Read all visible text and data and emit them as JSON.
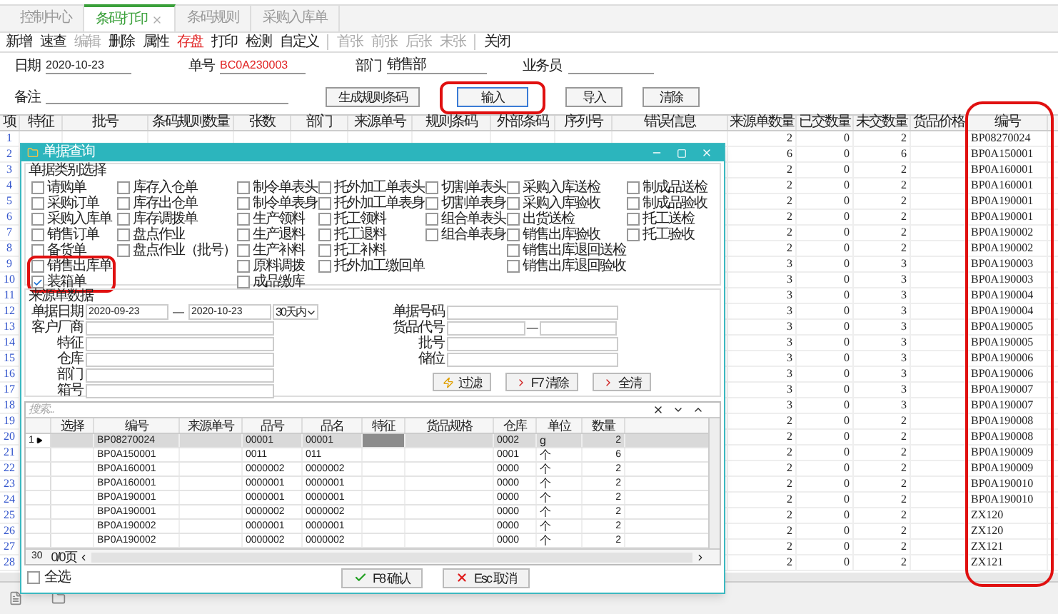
{
  "tabs": [
    {
      "label": "控制中心",
      "selected": false,
      "closable": false
    },
    {
      "label": "条码打印",
      "selected": true,
      "closable": true
    },
    {
      "label": "条码规则",
      "selected": false,
      "closable": false
    },
    {
      "label": "采购入库单",
      "selected": false,
      "closable": false
    }
  ],
  "toolbar_groups": [
    {
      "items": [
        {
          "label": "新增",
          "kind": "normal"
        },
        {
          "label": "速查",
          "kind": "normal"
        },
        {
          "label": "编辑",
          "kind": "disabled"
        },
        {
          "label": "删除",
          "kind": "normal"
        },
        {
          "label": "属性",
          "kind": "normal"
        },
        {
          "label": "存盘",
          "kind": "accent"
        },
        {
          "label": "打印",
          "kind": "normal"
        },
        {
          "label": "检测",
          "kind": "normal"
        },
        {
          "label": "自定义",
          "kind": "normal"
        }
      ]
    },
    {
      "items": [
        {
          "label": "首张",
          "kind": "disabled"
        },
        {
          "label": "前张",
          "kind": "disabled"
        },
        {
          "label": "后张",
          "kind": "disabled"
        },
        {
          "label": "末张",
          "kind": "disabled"
        }
      ]
    },
    {
      "items": [
        {
          "label": "关闭",
          "kind": "normal"
        }
      ]
    }
  ],
  "form": {
    "date": {
      "label": "日期",
      "value": "2020-10-23"
    },
    "number": {
      "label": "单号",
      "value": "BC0A230003"
    },
    "department": {
      "label": "部门",
      "value": "销售部"
    },
    "salesperson": {
      "label": "业务员"
    },
    "remark": {
      "label": "备注"
    }
  },
  "form_buttons": [
    {
      "label": "生成规则条码",
      "focused": false,
      "annotated": false
    },
    {
      "label": "输入",
      "focused": true,
      "annotated": true
    },
    {
      "label": "导入",
      "focused": false,
      "annotated": false
    },
    {
      "label": "清除",
      "focused": false,
      "annotated": false
    }
  ],
  "main_table": {
    "columns": [
      {
        "label": "项",
        "annotated": false
      },
      {
        "label": "特征",
        "annotated": false
      },
      {
        "label": "批号",
        "annotated": false
      },
      {
        "label": "条码规则数量",
        "annotated": false
      },
      {
        "label": "张数",
        "annotated": false
      },
      {
        "label": "部门",
        "annotated": false
      },
      {
        "label": "来源单号",
        "annotated": false
      },
      {
        "label": "规则条码",
        "annotated": false
      },
      {
        "label": "外部条码",
        "annotated": false
      },
      {
        "label": "序列号",
        "annotated": false
      },
      {
        "label": "错误信息",
        "annotated": false
      },
      {
        "label": "来源单数量",
        "annotated": false
      },
      {
        "label": "已交数量",
        "annotated": false
      },
      {
        "label": "未交数量",
        "annotated": false
      },
      {
        "label": "货品价格",
        "annotated": false
      },
      {
        "label": "编号",
        "annotated": true
      }
    ],
    "rows": [
      {
        "item": "1",
        "source_qty": "2",
        "delivered_qty": "0",
        "undelivered_qty": "2",
        "number": "BP08270024"
      },
      {
        "item": "2",
        "source_qty": "6",
        "delivered_qty": "0",
        "undelivered_qty": "6",
        "number": "BP0A150001"
      },
      {
        "item": "3",
        "source_qty": "2",
        "delivered_qty": "0",
        "undelivered_qty": "2",
        "number": "BP0A160001"
      },
      {
        "item": "4",
        "source_qty": "2",
        "delivered_qty": "0",
        "undelivered_qty": "2",
        "number": "BP0A160001"
      },
      {
        "item": "5",
        "source_qty": "2",
        "delivered_qty": "0",
        "undelivered_qty": "2",
        "number": "BP0A190001"
      },
      {
        "item": "6",
        "source_qty": "2",
        "delivered_qty": "0",
        "undelivered_qty": "2",
        "number": "BP0A190001"
      },
      {
        "item": "7",
        "source_qty": "2",
        "delivered_qty": "0",
        "undelivered_qty": "2",
        "number": "BP0A190002"
      },
      {
        "item": "8",
        "source_qty": "2",
        "delivered_qty": "0",
        "undelivered_qty": "2",
        "number": "BP0A190002"
      },
      {
        "item": "9",
        "source_qty": "3",
        "delivered_qty": "0",
        "undelivered_qty": "3",
        "number": "BP0A190003"
      },
      {
        "item": "10",
        "source_qty": "3",
        "delivered_qty": "0",
        "undelivered_qty": "3",
        "number": "BP0A190003"
      },
      {
        "item": "11",
        "source_qty": "3",
        "delivered_qty": "0",
        "undelivered_qty": "3",
        "number": "BP0A190004"
      },
      {
        "item": "12",
        "source_qty": "3",
        "delivered_qty": "0",
        "undelivered_qty": "3",
        "number": "BP0A190004"
      },
      {
        "item": "13",
        "source_qty": "3",
        "delivered_qty": "0",
        "undelivered_qty": "3",
        "number": "BP0A190005"
      },
      {
        "item": "14",
        "source_qty": "3",
        "delivered_qty": "0",
        "undelivered_qty": "3",
        "number": "BP0A190005"
      },
      {
        "item": "15",
        "source_qty": "3",
        "delivered_qty": "0",
        "undelivered_qty": "3",
        "number": "BP0A190006"
      },
      {
        "item": "16",
        "source_qty": "3",
        "delivered_qty": "0",
        "undelivered_qty": "3",
        "number": "BP0A190006"
      },
      {
        "item": "17",
        "source_qty": "3",
        "delivered_qty": "0",
        "undelivered_qty": "3",
        "number": "BP0A190007"
      },
      {
        "item": "18",
        "source_qty": "3",
        "delivered_qty": "0",
        "undelivered_qty": "3",
        "number": "BP0A190007"
      },
      {
        "item": "19",
        "source_qty": "2",
        "delivered_qty": "0",
        "undelivered_qty": "2",
        "number": "BP0A190008"
      },
      {
        "item": "20",
        "source_qty": "2",
        "delivered_qty": "0",
        "undelivered_qty": "2",
        "number": "BP0A190008"
      },
      {
        "item": "21",
        "source_qty": "2",
        "delivered_qty": "0",
        "undelivered_qty": "2",
        "number": "BP0A190009"
      },
      {
        "item": "22",
        "source_qty": "2",
        "delivered_qty": "0",
        "undelivered_qty": "2",
        "number": "BP0A190009"
      },
      {
        "item": "23",
        "source_qty": "2",
        "delivered_qty": "0",
        "undelivered_qty": "2",
        "number": "BP0A190010"
      },
      {
        "item": "24",
        "source_qty": "2",
        "delivered_qty": "0",
        "undelivered_qty": "2",
        "number": "BP0A190010"
      },
      {
        "item": "25",
        "source_qty": "2",
        "delivered_qty": "0",
        "undelivered_qty": "2",
        "number": "ZX120"
      },
      {
        "item": "26",
        "source_qty": "2",
        "delivered_qty": "0",
        "undelivered_qty": "2",
        "number": "ZX120"
      },
      {
        "item": "27",
        "source_qty": "2",
        "delivered_qty": "0",
        "undelivered_qty": "2",
        "number": "ZX121"
      },
      {
        "item": "28",
        "source_qty": "2",
        "delivered_qty": "0",
        "undelivered_qty": "2",
        "number": "ZX121"
      }
    ]
  },
  "dialog": {
    "title": "单据查询",
    "category_group": {
      "title": "单据类别选择",
      "columns": [
        {
          "items": [
            {
              "label": "请购单",
              "checked": false,
              "annotated": false
            },
            {
              "label": "采购订单",
              "checked": false,
              "annotated": false
            },
            {
              "label": "采购入库单",
              "checked": false,
              "annotated": false
            },
            {
              "label": "销售订单",
              "checked": false,
              "annotated": false
            },
            {
              "label": "备货单",
              "checked": false,
              "annotated": false
            },
            {
              "label": "销售出库单",
              "checked": false,
              "annotated": true
            },
            {
              "label": "装箱单",
              "checked": true,
              "annotated": true
            }
          ]
        },
        {
          "items": [
            {
              "label": "库存入仓单",
              "checked": false,
              "annotated": false
            },
            {
              "label": "库存出仓单",
              "checked": false,
              "annotated": false
            },
            {
              "label": "库存调拨单",
              "checked": false,
              "annotated": false
            },
            {
              "label": "盘点作业",
              "checked": false,
              "annotated": false
            },
            {
              "label": "盘点作业（批号）",
              "checked": false,
              "annotated": false
            }
          ]
        },
        {
          "items": [
            {
              "label": "制令单表头",
              "checked": false,
              "annotated": false
            },
            {
              "label": "制令单表身",
              "checked": false,
              "annotated": false
            },
            {
              "label": "生产领料",
              "checked": false,
              "annotated": false
            },
            {
              "label": "生产退料",
              "checked": false,
              "annotated": false
            },
            {
              "label": "生产补料",
              "checked": false,
              "annotated": false
            },
            {
              "label": "原料调拨",
              "checked": false,
              "annotated": false
            },
            {
              "label": "成品缴库",
              "checked": false,
              "annotated": false
            }
          ]
        },
        {
          "items": [
            {
              "label": "托外加工单表头",
              "checked": false,
              "annotated": false
            },
            {
              "label": "托外加工单表身",
              "checked": false,
              "annotated": false
            },
            {
              "label": "托工领料",
              "checked": false,
              "annotated": false
            },
            {
              "label": "托工退料",
              "checked": false,
              "annotated": false
            },
            {
              "label": "托工补料",
              "checked": false,
              "annotated": false
            },
            {
              "label": "托外加工缴回单",
              "checked": false,
              "annotated": false
            }
          ]
        },
        {
          "items": [
            {
              "label": "切割单表头",
              "checked": false,
              "annotated": false
            },
            {
              "label": "切割单表身",
              "checked": false,
              "annotated": false
            },
            {
              "label": "组合单表头",
              "checked": false,
              "annotated": false
            },
            {
              "label": "组合单表身",
              "checked": false,
              "annotated": false
            }
          ]
        },
        {
          "items": [
            {
              "label": "采购入库送检",
              "checked": false,
              "annotated": false
            },
            {
              "label": "采购入库验收",
              "checked": false,
              "annotated": false
            },
            {
              "label": "出货送检",
              "checked": false,
              "annotated": false
            },
            {
              "label": "销售出库验收",
              "checked": false,
              "annotated": false
            },
            {
              "label": "销售出库退回送检",
              "checked": false,
              "annotated": false
            },
            {
              "label": "销售出库退回验收",
              "checked": false,
              "annotated": false
            }
          ]
        },
        {
          "items": [
            {
              "label": "制成品送检",
              "checked": false,
              "annotated": false
            },
            {
              "label": "制成品验收",
              "checked": false,
              "annotated": false
            },
            {
              "label": "托工送检",
              "checked": false,
              "annotated": false
            },
            {
              "label": "托工验收",
              "checked": false,
              "annotated": false
            }
          ]
        }
      ]
    },
    "source_group": {
      "title": "来源单数据",
      "date_label": "单据日期",
      "date_from": "2020-09-23",
      "date_separator": "—",
      "date_to": "2020-10-23",
      "range": "30天内",
      "left_fields": [
        {
          "label": "客户厂商"
        },
        {
          "label": "特征"
        },
        {
          "label": "仓库"
        },
        {
          "label": "部门"
        },
        {
          "label": "箱号"
        }
      ],
      "doc_number_label": "单据号码",
      "item_code_label": "货品代号",
      "item_code_separator": "—",
      "right_fields": [
        {
          "label": "批号"
        },
        {
          "label": "储位"
        }
      ],
      "buttons": [
        {
          "label": "过滤",
          "kind": "filter"
        },
        {
          "label": "F7 清除",
          "kind": "clear"
        },
        {
          "label": "全清",
          "kind": "clear"
        }
      ]
    },
    "grid": {
      "search": {
        "placeholder": "搜索..."
      },
      "columns": [
        "选择",
        "编号",
        "来源单号",
        "品号",
        "品名",
        "特征",
        "货品规格",
        "仓库",
        "单位",
        "数量"
      ],
      "rows": [
        {
          "row_number": "1",
          "current": true,
          "number": "BP08270024",
          "item_no": "00001",
          "item_name": "00001",
          "warehouse": "0002",
          "unit": "g",
          "qty": "2"
        },
        {
          "current": false,
          "number": "BP0A150001",
          "item_no": "0011",
          "item_name": "011",
          "warehouse": "0001",
          "unit": "个",
          "qty": "6"
        },
        {
          "current": false,
          "number": "BP0A160001",
          "item_no": "0000002",
          "item_name": "0000002",
          "warehouse": "0000",
          "unit": "个",
          "qty": "2"
        },
        {
          "current": false,
          "number": "BP0A160001",
          "item_no": "0000001",
          "item_name": "0000001",
          "warehouse": "0000",
          "unit": "个",
          "qty": "2"
        },
        {
          "current": false,
          "number": "BP0A190001",
          "item_no": "0000001",
          "item_name": "0000001",
          "warehouse": "0000",
          "unit": "个",
          "qty": "2"
        },
        {
          "current": false,
          "number": "BP0A190001",
          "item_no": "0000002",
          "item_name": "0000002",
          "warehouse": "0000",
          "unit": "个",
          "qty": "2"
        },
        {
          "current": false,
          "number": "BP0A190002",
          "item_no": "0000001",
          "item_name": "0000001",
          "warehouse": "0000",
          "unit": "个",
          "qty": "2"
        },
        {
          "current": false,
          "number": "BP0A190002",
          "item_no": "0000002",
          "item_name": "0000002",
          "warehouse": "0000",
          "unit": "个",
          "qty": "2"
        }
      ],
      "pager": {
        "page_size": "30",
        "page": "0/0页"
      }
    },
    "footer": {
      "select_all": {
        "label": "全选",
        "checked": false
      },
      "buttons": [
        {
          "label": "F8 确认",
          "kind": "confirm"
        },
        {
          "label": "Esc 取消",
          "kind": "cancel"
        }
      ]
    }
  }
}
